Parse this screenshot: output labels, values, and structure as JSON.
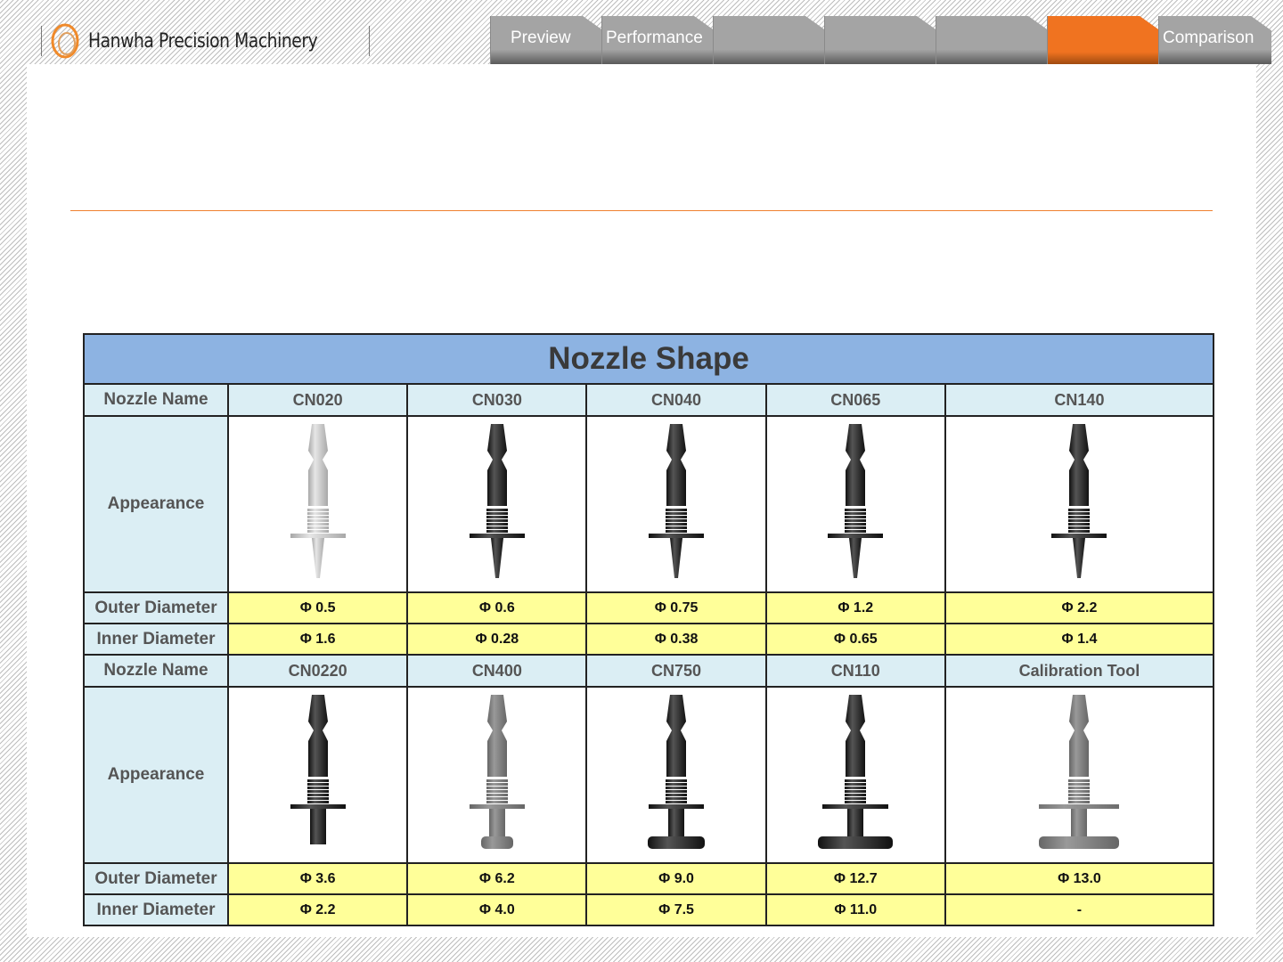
{
  "header": {
    "brand": "Hanwha Precision Machinery",
    "tabs": [
      {
        "label": "Preview",
        "active": false
      },
      {
        "label": "Performance",
        "active": false
      },
      {
        "label": "",
        "active": false
      },
      {
        "label": "",
        "active": false
      },
      {
        "label": "",
        "active": false
      },
      {
        "label": "",
        "active": true
      },
      {
        "label": "Comparison",
        "active": false
      }
    ]
  },
  "colors": {
    "accent": "#f07320",
    "title_bg": "#8db3e2",
    "header_bg": "#dbeef4",
    "value_bg": "#ffff99"
  },
  "table": {
    "title": "Nozzle Shape",
    "labels": {
      "name": "Nozzle Name",
      "appearance": "Appearance",
      "outer": "Outer Diameter",
      "inner": "Inner Diameter"
    },
    "groups": [
      {
        "names": [
          "CN020",
          "CN030",
          "CN040",
          "CN065",
          "CN140"
        ],
        "outer": [
          "Φ 0.5",
          "Φ 0.6",
          "Φ 0.75",
          "Φ 1.2",
          "Φ 2.2"
        ],
        "inner": [
          "Φ 1.6",
          "Φ 0.28",
          "Φ 0.38",
          "Φ 0.65",
          "Φ 1.4"
        ]
      },
      {
        "names": [
          "CN0220",
          "CN400",
          "CN750",
          "CN110",
          "Calibration Tool"
        ],
        "outer": [
          "Φ 3.6",
          "Φ 6.2",
          "Φ 9.0",
          "Φ 12.7",
          "Φ 13.0"
        ],
        "inner": [
          "Φ 2.2",
          "Φ 4.0",
          "Φ 7.5",
          "Φ 11.0",
          "-"
        ]
      }
    ]
  }
}
